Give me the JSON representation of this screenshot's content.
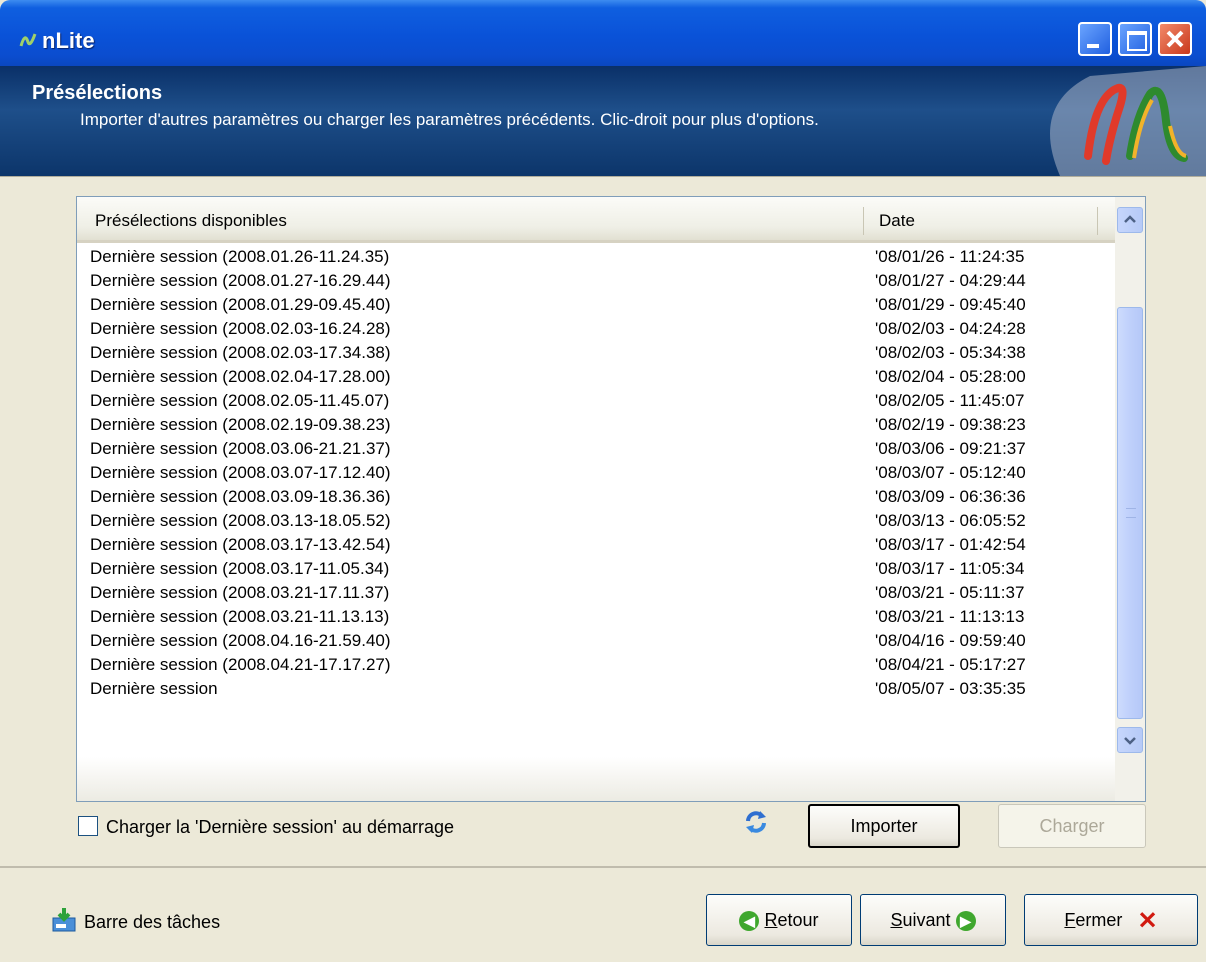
{
  "window": {
    "title": "nLite"
  },
  "header": {
    "title": "Présélections",
    "subtitle": "Importer d'autres paramètres ou charger les paramètres précédents. Clic-droit pour plus d'options."
  },
  "list": {
    "columns": [
      "Présélections disponibles",
      "Date"
    ],
    "rows": [
      [
        "Dernière session (2008.01.26-11.24.35)",
        "'08/01/26 - 11:24:35"
      ],
      [
        "Dernière session (2008.01.27-16.29.44)",
        "'08/01/27 - 04:29:44"
      ],
      [
        "Dernière session (2008.01.29-09.45.40)",
        "'08/01/29 - 09:45:40"
      ],
      [
        "Dernière session (2008.02.03-16.24.28)",
        "'08/02/03 - 04:24:28"
      ],
      [
        "Dernière session (2008.02.03-17.34.38)",
        "'08/02/03 - 05:34:38"
      ],
      [
        "Dernière session (2008.02.04-17.28.00)",
        "'08/02/04 - 05:28:00"
      ],
      [
        "Dernière session (2008.02.05-11.45.07)",
        "'08/02/05 - 11:45:07"
      ],
      [
        "Dernière session (2008.02.19-09.38.23)",
        "'08/02/19 - 09:38:23"
      ],
      [
        "Dernière session (2008.03.06-21.21.37)",
        "'08/03/06 - 09:21:37"
      ],
      [
        "Dernière session (2008.03.07-17.12.40)",
        "'08/03/07 - 05:12:40"
      ],
      [
        "Dernière session (2008.03.09-18.36.36)",
        "'08/03/09 - 06:36:36"
      ],
      [
        "Dernière session (2008.03.13-18.05.52)",
        "'08/03/13 - 06:05:52"
      ],
      [
        "Dernière session (2008.03.17-13.42.54)",
        "'08/03/17 - 01:42:54"
      ],
      [
        "Dernière session (2008.03.17-11.05.34)",
        "'08/03/17 - 11:05:34"
      ],
      [
        "Dernière session (2008.03.21-17.11.37)",
        "'08/03/21 - 05:11:37"
      ],
      [
        "Dernière session (2008.03.21-11.13.13)",
        "'08/03/21 - 11:13:13"
      ],
      [
        "Dernière session (2008.04.16-21.59.40)",
        "'08/04/16 - 09:59:40"
      ],
      [
        "Dernière session (2008.04.21-17.17.27)",
        "'08/04/21 - 05:17:27"
      ],
      [
        "Dernière session",
        "'08/05/07 - 03:35:35"
      ]
    ]
  },
  "options": {
    "load_last_session_label": "Charger la 'Dernière session' au démarrage",
    "load_last_session_checked": false
  },
  "buttons": {
    "import": "Importer",
    "load": "Charger",
    "taskbar": "Barre des tâches",
    "back_accel": "R",
    "back_rest": "etour",
    "next_accel": "S",
    "next_rest": "uivant",
    "close_accel": "F",
    "close_rest": "ermer"
  },
  "icons": {
    "app": "nlite-logo-icon",
    "refresh": "refresh-icon",
    "taskbar": "taskbar-icon",
    "back": "green-left-arrow-icon",
    "next": "green-right-arrow-icon",
    "close": "red-x-icon"
  },
  "colors": {
    "titlebar": "#0a52d8",
    "header": "#1e4f8a",
    "window_bg": "#ece9d8",
    "scroll_thumb": "#bfd0fb"
  }
}
